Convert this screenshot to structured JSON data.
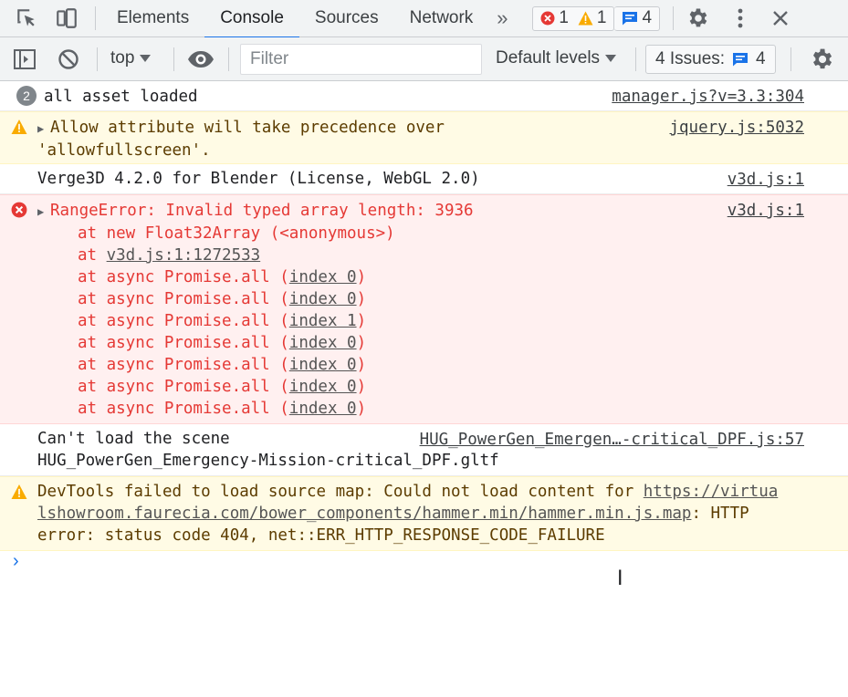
{
  "tabbar": {
    "tabs": [
      {
        "label": "Elements"
      },
      {
        "label": "Console"
      },
      {
        "label": "Sources"
      },
      {
        "label": "Network"
      }
    ],
    "more_tabs_icon": "double-chevron-right",
    "error_count": "1",
    "warning_count": "1",
    "message_count": "4"
  },
  "toolbar": {
    "context": "top",
    "filter_placeholder": "Filter",
    "levels_label": "Default levels",
    "issues_label": "4 Issues:",
    "issues_count": "4"
  },
  "messages": [
    {
      "type": "info",
      "repeat": "2",
      "text": "all asset loaded",
      "source": "manager.js?v=3.3:304"
    },
    {
      "type": "warning",
      "line1": "Allow attribute will take precedence over",
      "line2": "'allowfullscreen'.",
      "source": "jquery.js:5032"
    },
    {
      "type": "log",
      "text": "Verge3D 4.2.0 for Blender (License, WebGL 2.0)",
      "source": "v3d.js:1"
    },
    {
      "type": "error",
      "text": "RangeError: Invalid typed array length: 3936",
      "source": "v3d.js:1",
      "stack": [
        {
          "prefix": "at new Float32Array (<anonymous>)",
          "link": "",
          "suffix": ""
        },
        {
          "prefix": "at ",
          "link": "v3d.js:1:1272533",
          "suffix": ""
        },
        {
          "prefix": "at async Promise.all (",
          "link": "index 0",
          "suffix": ")"
        },
        {
          "prefix": "at async Promise.all (",
          "link": "index 0",
          "suffix": ")"
        },
        {
          "prefix": "at async Promise.all (",
          "link": "index 1",
          "suffix": ")"
        },
        {
          "prefix": "at async Promise.all (",
          "link": "index 0",
          "suffix": ")"
        },
        {
          "prefix": "at async Promise.all (",
          "link": "index 0",
          "suffix": ")"
        },
        {
          "prefix": "at async Promise.all (",
          "link": "index 0",
          "suffix": ")"
        },
        {
          "prefix": "at async Promise.all (",
          "link": "index 0",
          "suffix": ")"
        }
      ]
    },
    {
      "type": "log",
      "line1": "Can't load the scene",
      "line2": "HUG_PowerGen_Emergency-Mission-critical_DPF.gltf",
      "source": "HUG_PowerGen_Emergen…-critical_DPF.js:57"
    },
    {
      "type": "warning",
      "prefix": "DevTools failed to load source map: Could not load content for ",
      "link_part1": "https://virtua",
      "link_part2": "lshowroom.faurecia.com/bower_components/hammer.min/hammer.min.js.map",
      "mid": ": HTTP",
      "line3": "error: status code 404, net::ERR_HTTP_RESPONSE_CODE_FAILURE"
    }
  ],
  "colors": {
    "accent": "#1a73e8",
    "error": "#e53935",
    "warning": "#f9ab00"
  }
}
